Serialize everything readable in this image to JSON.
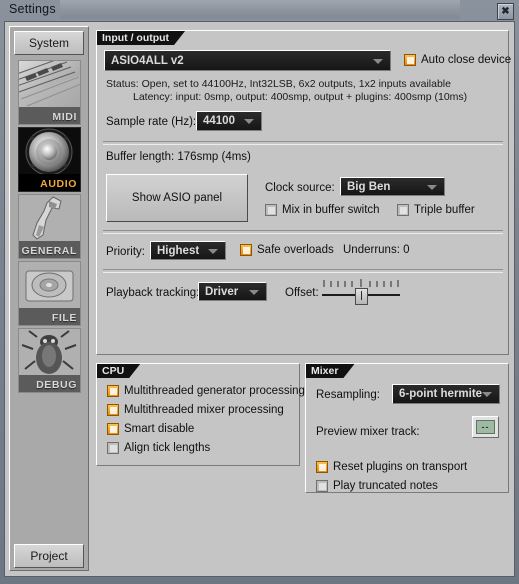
{
  "window": {
    "title": "Settings",
    "close_label": "✖"
  },
  "sidebar": {
    "top_tab": "System",
    "bottom_tab": "Project",
    "items": [
      {
        "label": "MIDI",
        "icon": "midi-keyboard-icon",
        "selected": false
      },
      {
        "label": "AUDIO",
        "icon": "speaker-cone-icon",
        "selected": true
      },
      {
        "label": "GENERAL",
        "icon": "wrench-icon",
        "selected": false
      },
      {
        "label": "FILE",
        "icon": "disk-drive-icon",
        "selected": false
      },
      {
        "label": "DEBUG",
        "icon": "bug-icon",
        "selected": false
      }
    ]
  },
  "input_output": {
    "tab_label": "Input / output",
    "device": "ASIO4ALL v2",
    "auto_close_device": {
      "label": "Auto close device",
      "checked": true
    },
    "status_line_1": "Status:  Open, set to 44100Hz, Int32LSB, 6x2 outputs, 1x2 inputs available",
    "status_line_2": "Latency: input: 0smp, output: 400smp, output + plugins: 400smp (10ms)",
    "sample_rate_label": "Sample rate (Hz):",
    "sample_rate": "44100",
    "buffer_length": "Buffer length: 176smp (4ms)",
    "show_asio_panel": "Show ASIO panel",
    "clock_source_label": "Clock source:",
    "clock_source": "Big Ben",
    "mix_in_buffer_switch": {
      "label": "Mix in buffer switch",
      "checked": false
    },
    "triple_buffer": {
      "label": "Triple buffer",
      "checked": false
    },
    "priority_label": "Priority:",
    "priority": "Highest",
    "safe_overloads": {
      "label": "Safe overloads",
      "checked": true
    },
    "underruns": "Underruns: 0",
    "playback_tracking_label": "Playback tracking:",
    "playback_tracking": "Driver",
    "offset_label": "Offset:"
  },
  "cpu": {
    "tab_label": "CPU",
    "options": [
      {
        "label": "Multithreaded generator processing",
        "checked": true
      },
      {
        "label": "Multithreaded mixer processing",
        "checked": true
      },
      {
        "label": "Smart disable",
        "checked": true
      },
      {
        "label": "Align tick lengths",
        "checked": false
      }
    ]
  },
  "mixer": {
    "tab_label": "Mixer",
    "resampling_label": "Resampling:",
    "resampling": "6-point hermite",
    "preview_track_label": "Preview mixer track:",
    "preview_track_value": "--",
    "options": [
      {
        "label": "Reset plugins on transport",
        "checked": true
      },
      {
        "label": "Play truncated notes",
        "checked": false
      }
    ]
  },
  "colors": {
    "accent_orange": "#f2a93b",
    "checkbox_on": "#e98a10",
    "window_bg": "#7d8794",
    "panel_bg": "#c5c5c5",
    "combo_bg": "#1d1d1d"
  }
}
